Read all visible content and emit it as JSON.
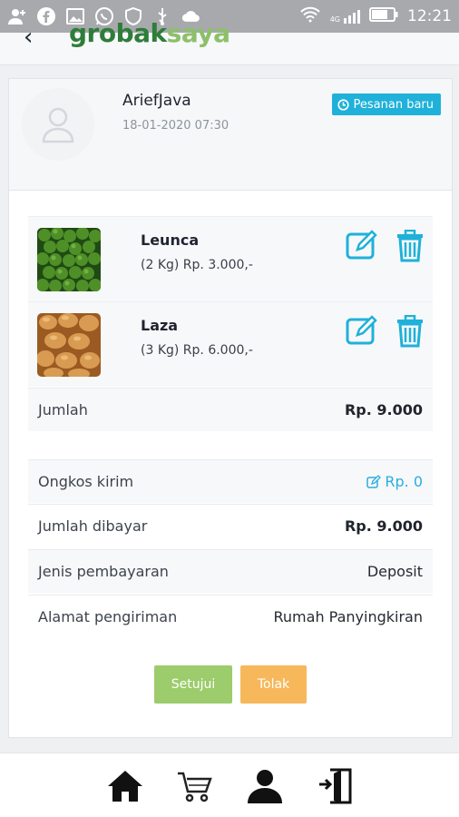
{
  "status_bar": {
    "icons": [
      "add-person-icon",
      "facebook-icon",
      "image-icon",
      "whatsapp-icon",
      "shield-icon",
      "usb-icon",
      "cloud-icon",
      "wifi-icon",
      "signal-icon",
      "battery-icon"
    ],
    "network": "4G",
    "time": "12:21"
  },
  "app_bar": {
    "logo_part1": "grobak",
    "logo_part2": "saya",
    "back_icon": "back-arrow-icon"
  },
  "order": {
    "customer_name": "AriefJava",
    "date": "18-01-2020 07:30",
    "status_badge": "Pesanan baru",
    "items": [
      {
        "name": "Leunca",
        "desc": "(2 Kg) Rp. 3.000,-"
      },
      {
        "name": "Laza",
        "desc": "(3 Kg) Rp. 6.000,-"
      }
    ],
    "subtotal_label": "Jumlah",
    "subtotal_value": "Rp. 9.000",
    "shipping_label": "Ongkos kirim",
    "shipping_value": "Rp. 0",
    "paid_label": "Jumlah dibayar",
    "paid_value": "Rp. 9.000",
    "payment_label": "Jenis pembayaran",
    "payment_value": "Deposit",
    "address_label": "Alamat pengiriman",
    "address_value": "Rumah Panyingkiran",
    "approve_button": "Setujui",
    "reject_button": "Tolak"
  },
  "colors": {
    "accent": "#1fb1d9",
    "approve": "#9ccc6b",
    "reject": "#f6b85a",
    "logo_dark": "#2e7d3a",
    "logo_light": "#8cc069"
  },
  "bottom_nav": [
    "home-icon",
    "cart-icon",
    "user-icon",
    "logout-icon"
  ]
}
